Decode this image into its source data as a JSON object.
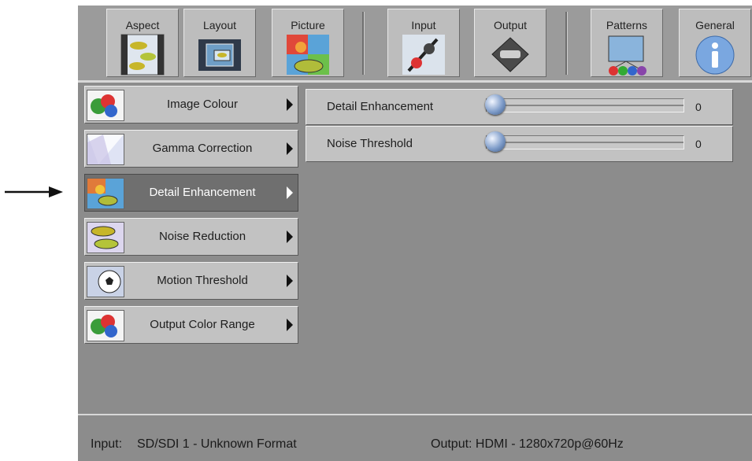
{
  "toolbar": {
    "tabs": [
      {
        "label": "Aspect",
        "icon": "aspect-icon"
      },
      {
        "label": "Layout",
        "icon": "layout-icon"
      },
      {
        "label": "Picture",
        "icon": "picture-icon"
      },
      {
        "label": "Input",
        "icon": "input-icon"
      },
      {
        "label": "Output",
        "icon": "output-icon"
      },
      {
        "label": "Patterns",
        "icon": "patterns-icon"
      },
      {
        "label": "General",
        "icon": "info-icon"
      }
    ]
  },
  "menu": {
    "items": [
      {
        "label": "Image Colour",
        "icon": "image-colour-icon",
        "active": false
      },
      {
        "label": "Gamma Correction",
        "icon": "gamma-icon",
        "active": false
      },
      {
        "label": "Detail Enhancement",
        "icon": "detail-icon",
        "active": true
      },
      {
        "label": "Noise Reduction",
        "icon": "noise-icon",
        "active": false
      },
      {
        "label": "Motion Threshold",
        "icon": "motion-icon",
        "active": false
      },
      {
        "label": "Output Color Range",
        "icon": "color-range-icon",
        "active": false
      }
    ]
  },
  "settings": {
    "sliders": [
      {
        "label": "Detail Enhancement",
        "value": "0"
      },
      {
        "label": "Noise Threshold",
        "value": "0"
      }
    ]
  },
  "status": {
    "input_label": "Input:",
    "input_value": "SD/SDI 1 - Unknown Format",
    "output_text": "Output: HDMI - 1280x720p@60Hz"
  },
  "colors": {
    "panel": "#8c8c8c",
    "button": "#c2c2c2",
    "active_item": "#6f6f6f",
    "knob": "#7e9cc9"
  }
}
